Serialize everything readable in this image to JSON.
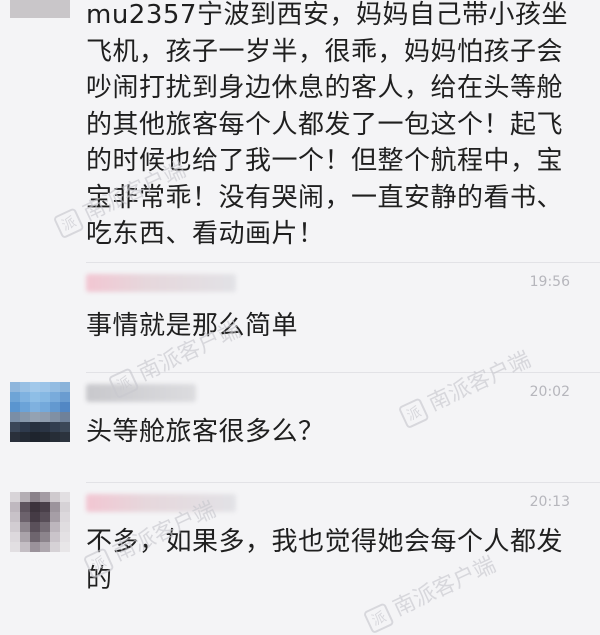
{
  "messages": [
    {
      "time": "",
      "text": "mu2357宁波到西安，妈妈自己带小孩坐飞机，孩子一岁半，很乖，妈妈怕孩子会吵闹打扰到身边休息的客人，给在头等舱的其他旅客每个人都发了一包这个！起飞的时候也给了我一个！但整个航程中，宝宝非常乖！没有哭闹，一直安静的看书、吃东西、看动画片！"
    },
    {
      "time": "19:56",
      "text": "事情就是那么简单"
    },
    {
      "time": "20:02",
      "text": "头等舱旅客很多么？"
    },
    {
      "time": "20:13",
      "text": "不多，如果多，我也觉得她会每个人都发的"
    }
  ],
  "watermark": "南派客户端",
  "watermark_logo": "派"
}
